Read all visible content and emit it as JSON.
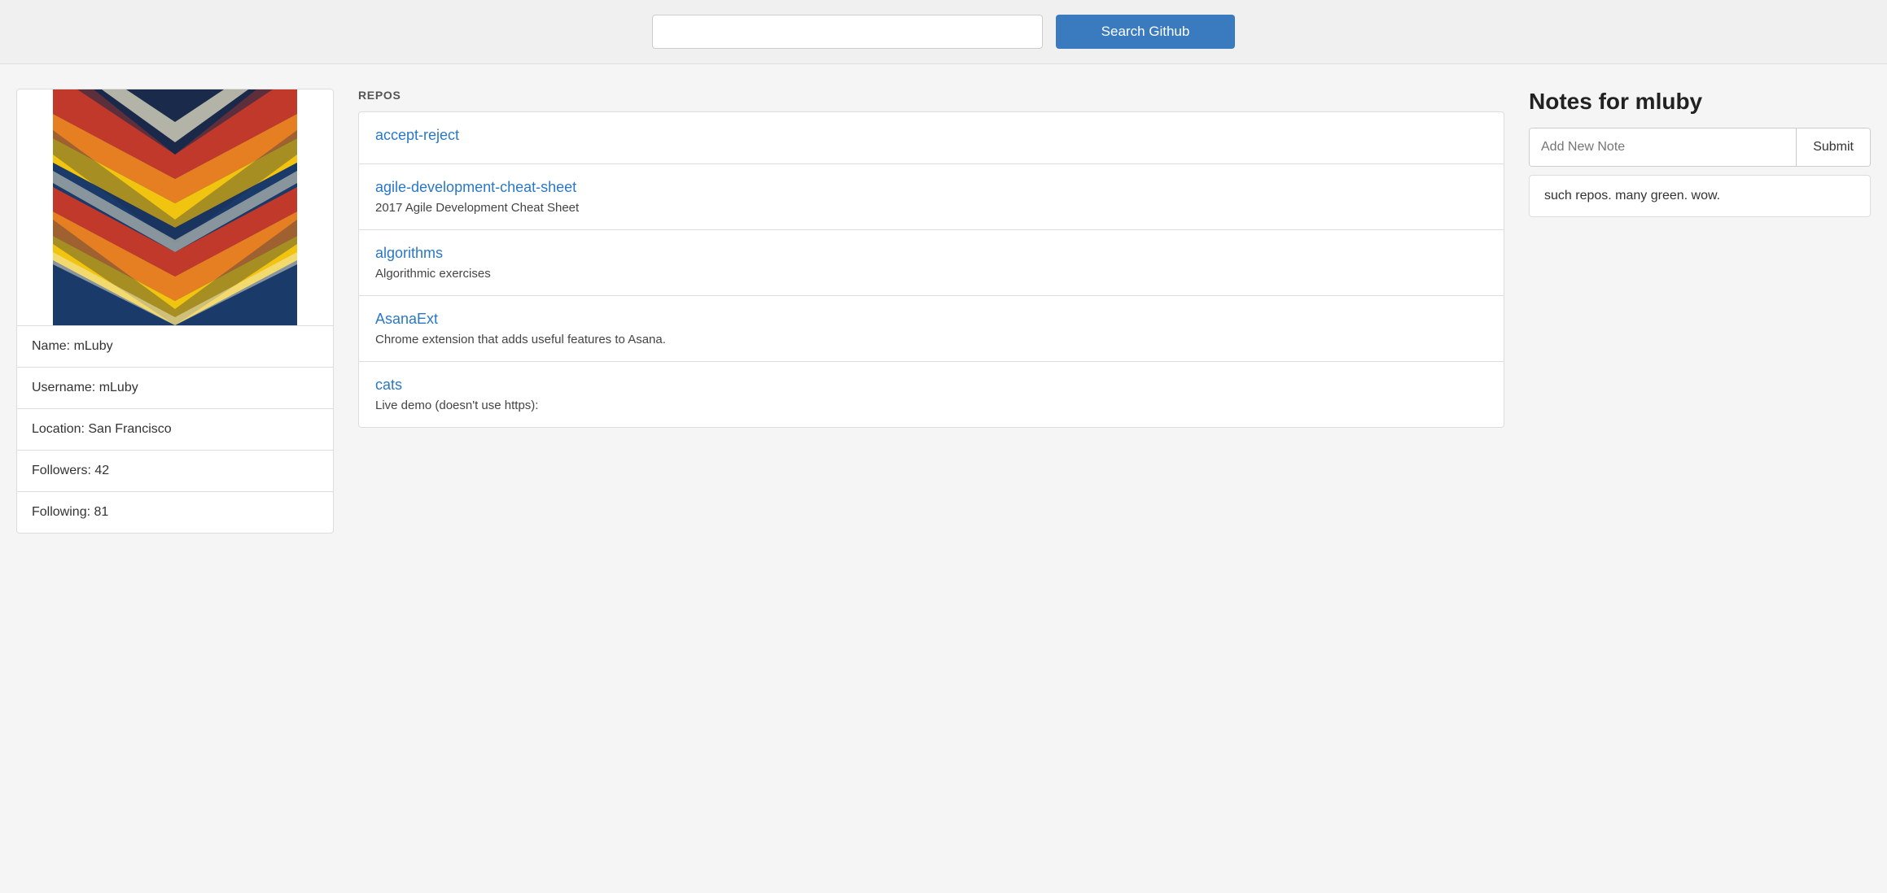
{
  "header": {
    "search_placeholder": "",
    "search_button_label": "Search Github"
  },
  "profile": {
    "name_label": "Name: mLuby",
    "username_label": "Username: mLuby",
    "location_label": "Location: San Francisco",
    "followers_label": "Followers: 42",
    "following_label": "Following: 81"
  },
  "repos": {
    "section_label": "REPOS",
    "items": [
      {
        "name": "accept-reject",
        "description": ""
      },
      {
        "name": "agile-development-cheat-sheet",
        "description": "2017 Agile Development Cheat Sheet"
      },
      {
        "name": "algorithms",
        "description": "Algorithmic exercises"
      },
      {
        "name": "AsanaExt",
        "description": "Chrome extension that adds useful features to Asana."
      },
      {
        "name": "cats",
        "description": "Live demo (doesn't use https):"
      }
    ]
  },
  "notes": {
    "title": "Notes for mluby",
    "input_placeholder": "Add New Note",
    "submit_label": "Submit",
    "items": [
      {
        "text": "such repos. many green. wow."
      }
    ]
  }
}
